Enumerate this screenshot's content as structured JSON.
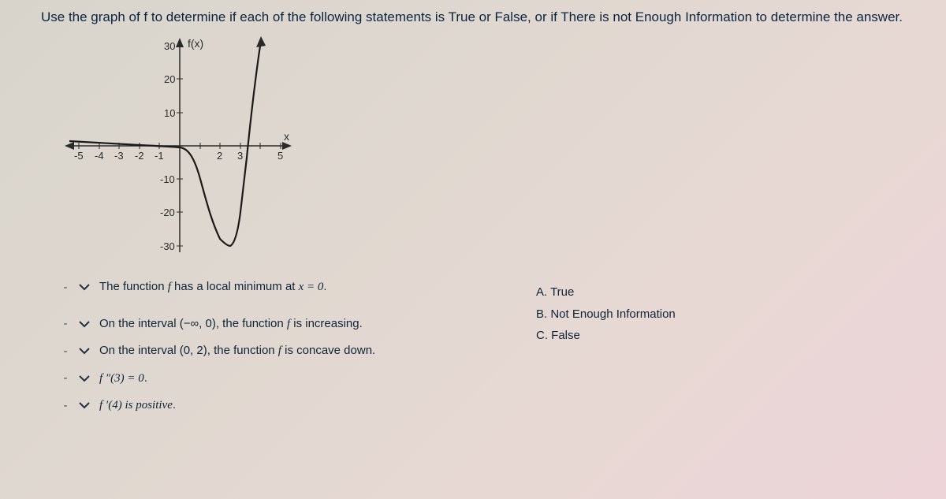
{
  "question": "Use the graph of f to determine if each of the following statements is True or False, or if There is not Enough Information to determine the answer.",
  "graph": {
    "y_axis_label": "f(x)",
    "x_axis_label": "x",
    "y_ticks": [
      "30",
      "20",
      "10",
      "-10",
      "-20",
      "-30"
    ],
    "x_ticks_neg": [
      "-5",
      "-4",
      "-3",
      "-2",
      "-1"
    ],
    "x_ticks_pos": [
      "2",
      "3",
      "5"
    ]
  },
  "statements": [
    {
      "pre": "The function ",
      "mid_italic": "f",
      "post": " has a local minimum at ",
      "math": "x = 0",
      "end": "."
    },
    {
      "pre": "On the interval ",
      "interval": "(−∞, 0)",
      "post": ", the function ",
      "mid_italic": "f",
      "end": " is increasing."
    },
    {
      "pre": "On the interval ",
      "interval": "(0, 2)",
      "post": ", the function ",
      "mid_italic": "f",
      "end": " is concave down."
    },
    {
      "math_full": "f ″(3) = 0",
      "end": "."
    },
    {
      "math_full": "f ′(4) is positive",
      "end": "."
    }
  ],
  "answers": [
    {
      "label": "A. True"
    },
    {
      "label": "B. Not Enough Information"
    },
    {
      "label": "C. False"
    }
  ],
  "chart_data": {
    "type": "line",
    "title": "",
    "xlabel": "x",
    "ylabel": "f(x)",
    "xlim": [
      -5.5,
      5.5
    ],
    "ylim": [
      -32,
      32
    ],
    "x_ticks": [
      -5,
      -4,
      -3,
      -2,
      -1,
      0,
      1,
      2,
      3,
      4,
      5
    ],
    "y_ticks": [
      -30,
      -20,
      -10,
      10,
      20,
      30
    ],
    "series": [
      {
        "name": "f(x)",
        "x": [
          -5.5,
          -5,
          -4,
          -3,
          -2,
          -1,
          0,
          0.5,
          1,
          1.5,
          2,
          2.5,
          3,
          3.2,
          3.5,
          3.8,
          4.0
        ],
        "values": [
          1.5,
          1.2,
          0.8,
          0.4,
          0.1,
          -0.1,
          -0.5,
          -3,
          -10,
          -20,
          -28,
          -30,
          -20,
          -10,
          5,
          20,
          32
        ]
      }
    ],
    "notes": "Curve is near 0 and slightly decreasing for x<0, dips to a minimum near x≈2.5 (≈ -30), has an inflection near x≈3, then rises steeply and exits top near x≈4. Arrowheads on both axes and on curve's right end."
  }
}
